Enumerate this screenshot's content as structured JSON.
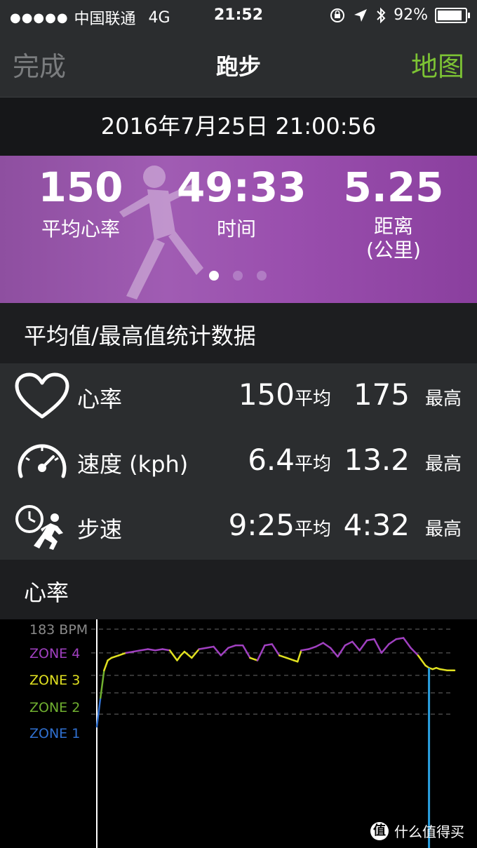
{
  "status_bar": {
    "signal_dots": "●●●●●",
    "carrier": "中国联通",
    "network": "4G",
    "time": "21:52",
    "battery": "92%",
    "icons": [
      "orientation-lock-icon",
      "location-arrow-icon",
      "bluetooth-icon",
      "battery-icon"
    ]
  },
  "nav": {
    "back_label": "完成",
    "title": "跑步",
    "map_label": "地图",
    "accent": "#7cc234"
  },
  "date_time": "2016年7月25日 21:00:56",
  "hero": {
    "metrics": [
      {
        "value": "150",
        "label": "平均心率"
      },
      {
        "value": "49:33",
        "label": "时间"
      },
      {
        "value": "5.25",
        "label": "距离",
        "sub": "(公里)"
      }
    ],
    "page_count": 3,
    "active_page": 1
  },
  "stats_section": {
    "title": "平均值/最高值统计数据",
    "rows": [
      {
        "icon": "heart-icon",
        "name": "心率",
        "avg": "150",
        "avg_tag": "平均",
        "max": "175",
        "max_tag": "最高"
      },
      {
        "icon": "speedometer-icon",
        "name": "速度 (kph)",
        "avg": "6.4",
        "avg_tag": "平均",
        "max": "13.2",
        "max_tag": "最高"
      },
      {
        "icon": "pace-runner-icon",
        "name": "步速",
        "avg": "9:25",
        "avg_tag": "平均",
        "max": "4:32",
        "max_tag": "最高"
      }
    ]
  },
  "heart_chart_section": {
    "title": "心率",
    "zone_labels": [
      "183 BPM",
      "ZONE 4",
      "ZONE 3",
      "ZONE 2",
      "ZONE 1"
    ],
    "zone_colors": {
      "ZONE 4": "#a040c0",
      "ZONE 3": "#e0e020",
      "ZONE 2": "#70b030",
      "ZONE 1": "#3070d0",
      "183 BPM": "#8a8a8a"
    },
    "line_color": "#ffffff"
  },
  "watermark": {
    "badge": "值",
    "text": "什么值得买"
  },
  "chart_data": {
    "type": "line",
    "title": "",
    "xlabel": "",
    "ylabel": "",
    "ylim": [
      96,
      183
    ],
    "y_ticks": [
      "183 BPM",
      "ZONE 4",
      "ZONE 3",
      "ZONE 2",
      "ZONE 1"
    ],
    "grid": "dashed horizontal",
    "series": [
      {
        "x": [
          0,
          0.5,
          1,
          1.5,
          2,
          3,
          4,
          5,
          6,
          7,
          8,
          9,
          10,
          11,
          11.5,
          12,
          13,
          14,
          15,
          16,
          17,
          18,
          19,
          20,
          21,
          22,
          23,
          24,
          25,
          26,
          27,
          27.5,
          28,
          29,
          30,
          31,
          32,
          33,
          34,
          35,
          36,
          37,
          38,
          39,
          40,
          41,
          42,
          43,
          44,
          45,
          45.5,
          46,
          46.5,
          47,
          48,
          49
        ],
        "values": [
          105,
          128,
          150,
          158,
          160,
          162,
          164,
          165,
          166,
          167,
          166,
          167,
          166,
          158,
          162,
          165,
          160,
          167,
          168,
          169,
          162,
          168,
          170,
          170,
          160,
          158,
          170,
          171,
          162,
          160,
          158,
          157,
          166,
          167,
          169,
          172,
          168,
          161,
          170,
          173,
          166,
          174,
          175,
          164,
          171,
          175,
          176,
          168,
          162,
          154,
          152,
          151,
          152,
          151,
          150,
          150
        ]
      }
    ]
  }
}
